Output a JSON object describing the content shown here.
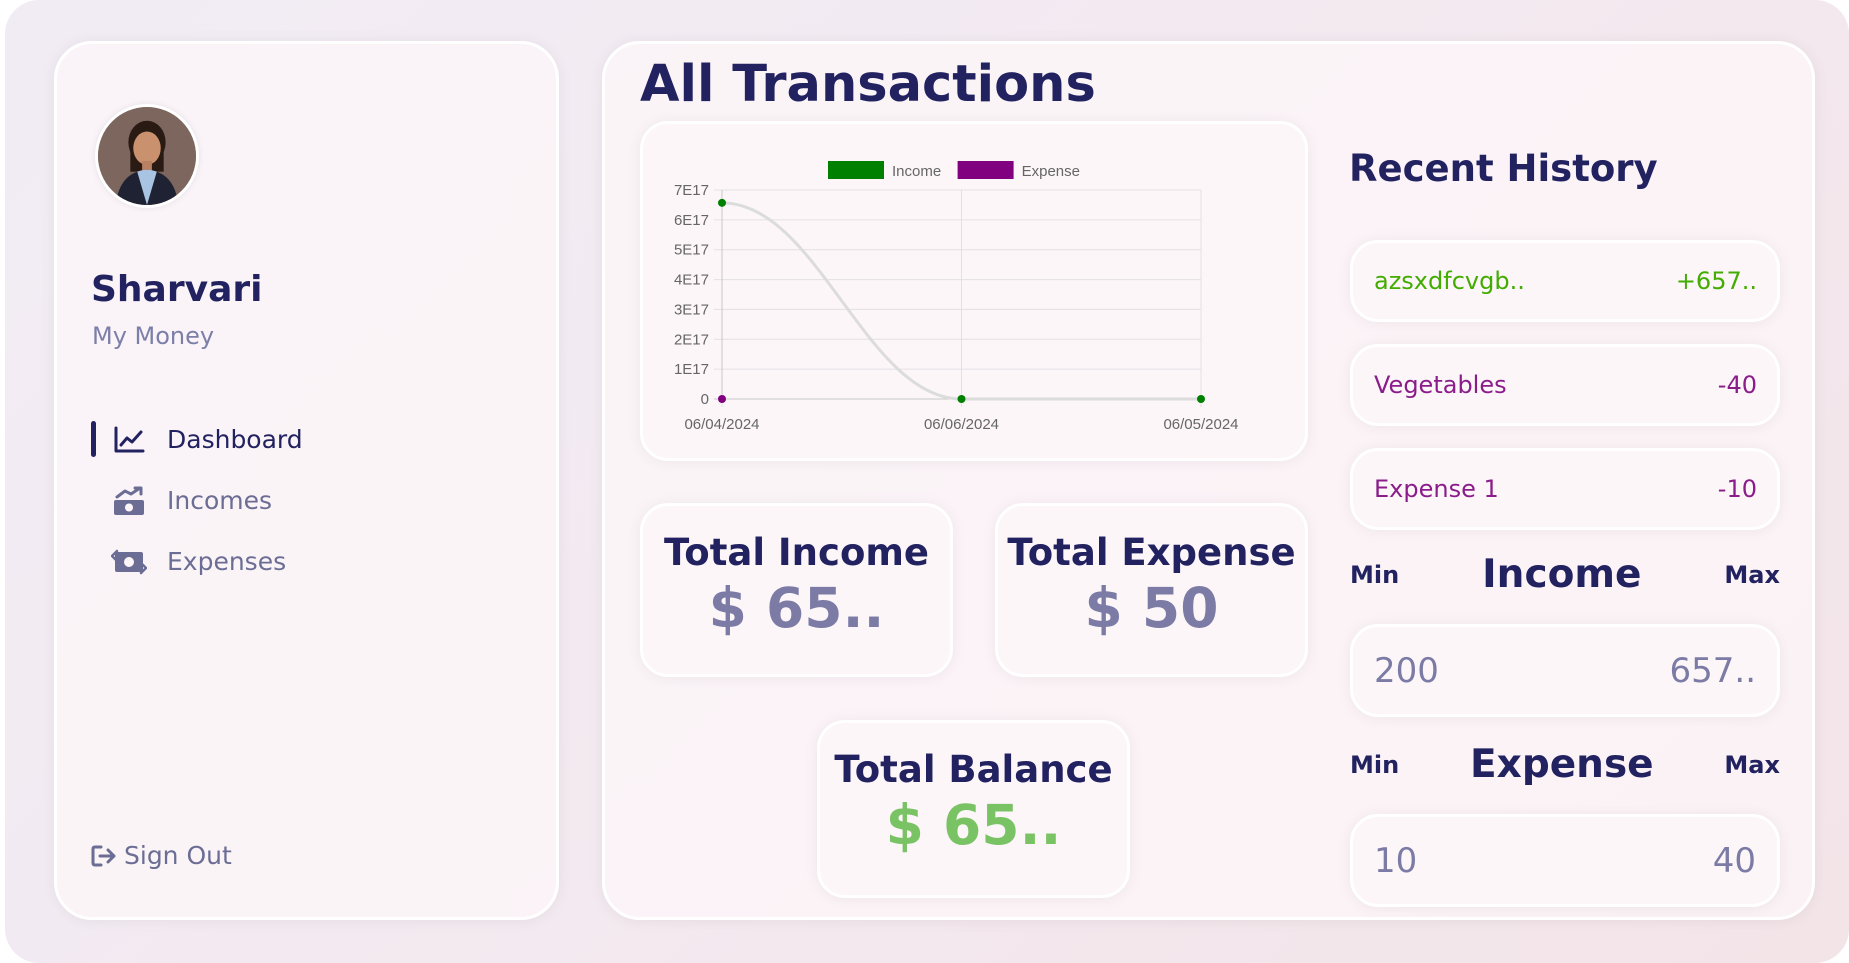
{
  "user": {
    "name": "Sharvari",
    "subtitle": "My Money"
  },
  "nav": {
    "items": [
      {
        "label": "Dashboard",
        "icon": "chart-line-icon",
        "active": true
      },
      {
        "label": "Incomes",
        "icon": "money-bill-trend-up-icon",
        "active": false
      },
      {
        "label": "Expenses",
        "icon": "money-bill-transfer-icon",
        "active": false
      }
    ],
    "signout_label": "Sign Out"
  },
  "main": {
    "title": "All Transactions"
  },
  "chart_data": {
    "type": "line",
    "x": [
      "06/04/2024",
      "06/06/2024",
      "06/05/2024"
    ],
    "series": [
      {
        "name": "Income",
        "color": "#008000",
        "values": [
          6.57e+17,
          0,
          0
        ]
      },
      {
        "name": "Expense",
        "color": "#800080",
        "values": [
          0,
          null,
          null
        ]
      }
    ],
    "y_ticks": [
      "0",
      "1E17",
      "2E17",
      "3E17",
      "4E17",
      "5E17",
      "6E17",
      "7E17"
    ],
    "ylim": [
      0,
      7e+17
    ],
    "legend": "top",
    "grid": true
  },
  "totals": {
    "income_title": "Total Income",
    "income_value": "$ 65..",
    "expense_title": "Total Expense",
    "expense_value": "$ 50",
    "balance_title": "Total Balance",
    "balance_value": "$ 65.."
  },
  "history": {
    "title": "Recent History",
    "items": [
      {
        "title": "azsxdfcvgb..",
        "amount": "+657..",
        "type": "income"
      },
      {
        "title": "Vegetables",
        "amount": "-40",
        "type": "expense"
      },
      {
        "title": "Expense 1",
        "amount": "-10",
        "type": "expense"
      }
    ]
  },
  "income_range": {
    "min_label": "Min",
    "label": "Income",
    "max_label": "Max",
    "min": "200",
    "max": "657.."
  },
  "expense_range": {
    "min_label": "Min",
    "label": "Expense",
    "max_label": "Max",
    "min": "10",
    "max": "40"
  },
  "colors": {
    "primary": "#222260",
    "income": "#42ad00",
    "expense": "#8a1d8a",
    "balance": "#7ac364"
  }
}
